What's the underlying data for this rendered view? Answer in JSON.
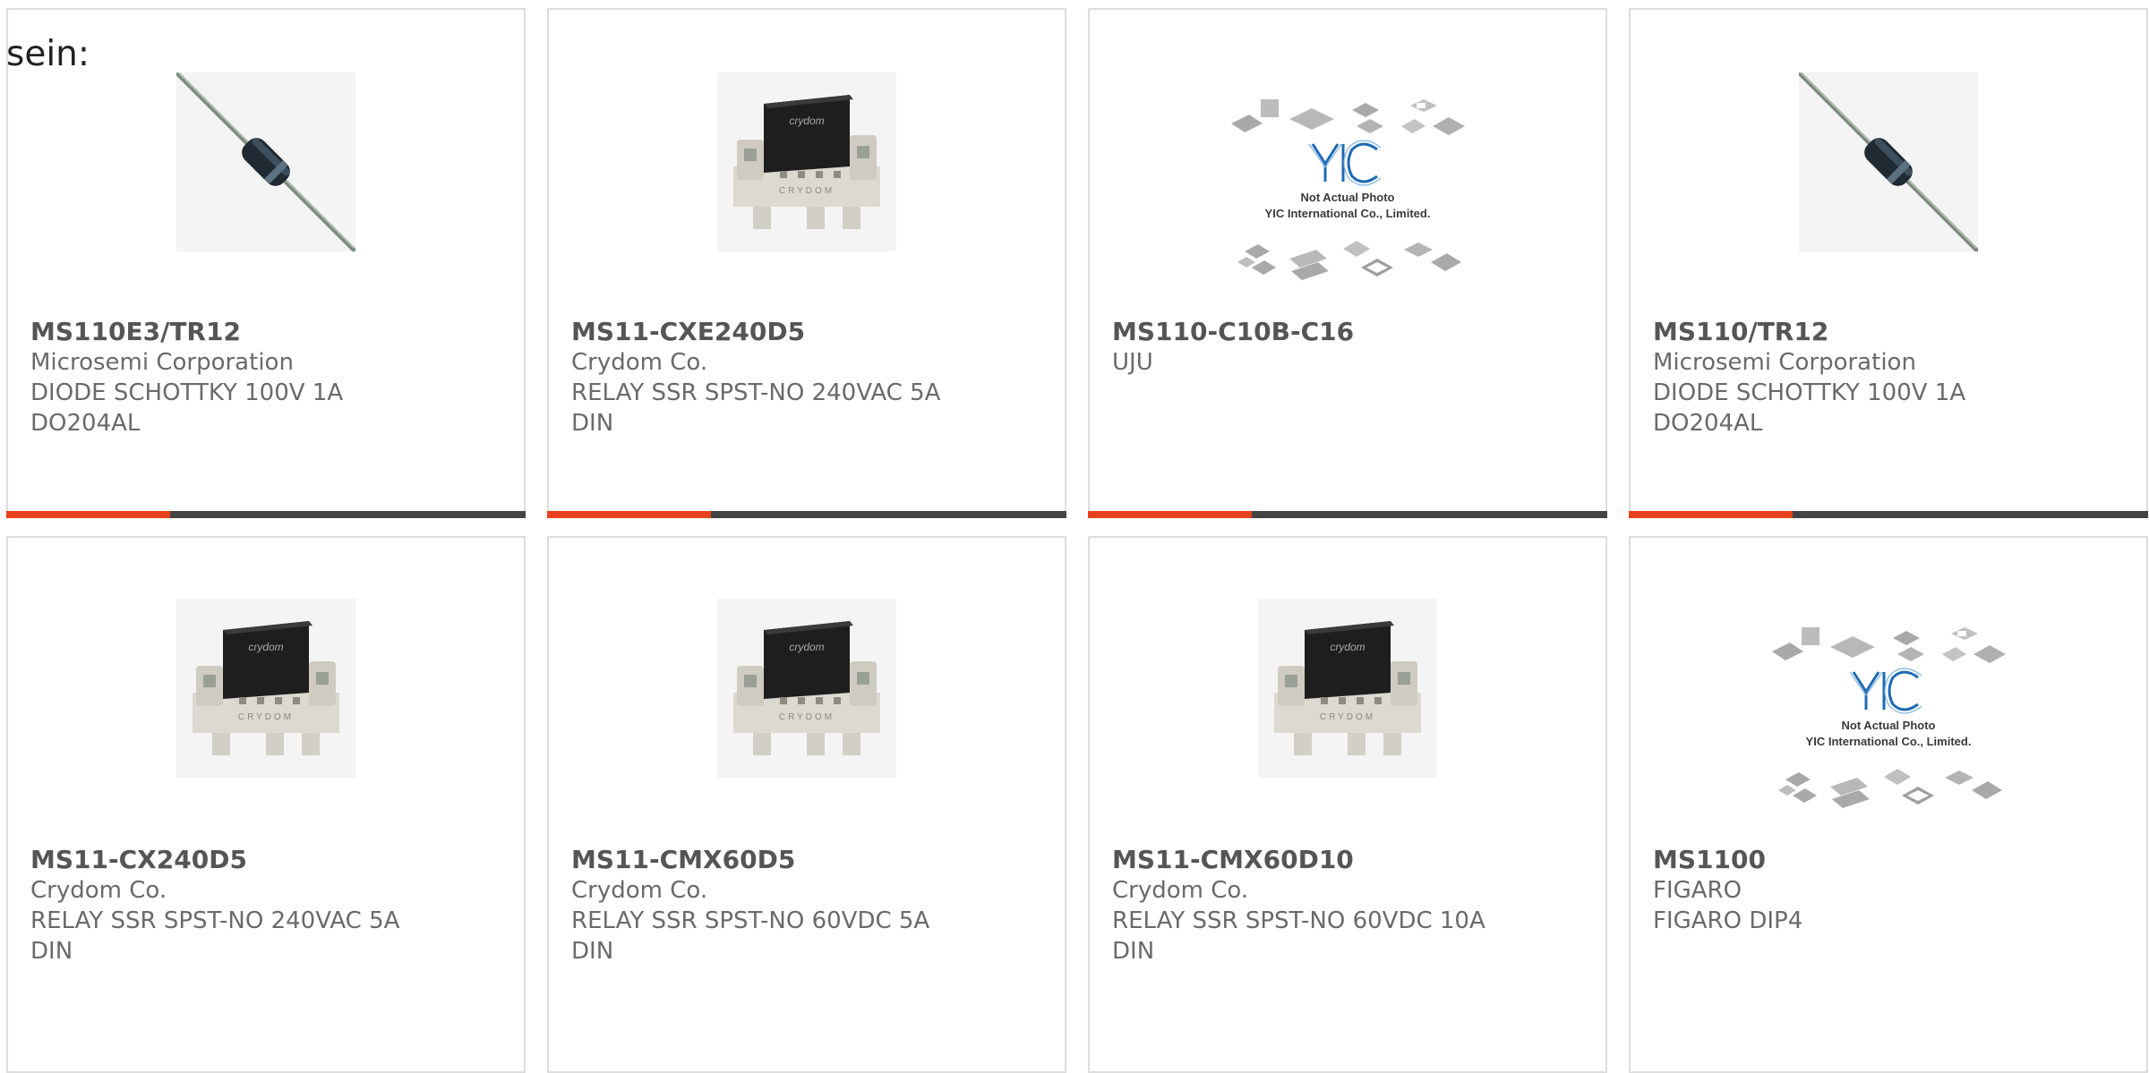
{
  "intro_text": "sein:",
  "colors": {
    "accent": "#e8401c",
    "bar": "#444444",
    "border": "#dddddd"
  },
  "products": [
    {
      "part": "MS110E3/TR12",
      "maker": "Microsemi Corporation",
      "desc1": "DIODE SCHOTTKY 100V 1A",
      "desc2": "DO204AL",
      "image": "diode-icon"
    },
    {
      "part": "MS11-CXE240D5",
      "maker": "Crydom Co.",
      "desc1": "RELAY SSR SPST-NO 240VAC 5A",
      "desc2": "DIN",
      "image": "relay-icon"
    },
    {
      "part": "MS110-C10B-C16",
      "maker": "UJU",
      "desc1": "",
      "desc2": "",
      "image": "placeholder-icon"
    },
    {
      "part": "MS110/TR12",
      "maker": "Microsemi Corporation",
      "desc1": "DIODE SCHOTTKY 100V 1A",
      "desc2": "DO204AL",
      "image": "diode-icon"
    },
    {
      "part": "MS11-CX240D5",
      "maker": "Crydom Co.",
      "desc1": "RELAY SSR SPST-NO 240VAC 5A",
      "desc2": "DIN",
      "image": "relay-icon"
    },
    {
      "part": "MS11-CMX60D5",
      "maker": "Crydom Co.",
      "desc1": "RELAY SSR SPST-NO 60VDC 5A",
      "desc2": "DIN",
      "image": "relay-icon"
    },
    {
      "part": "MS11-CMX60D10",
      "maker": "Crydom Co.",
      "desc1": "RELAY SSR SPST-NO 60VDC 10A",
      "desc2": "DIN",
      "image": "relay-icon"
    },
    {
      "part": "MS1100",
      "maker": "FIGARO",
      "desc1": "FIGARO DIP4",
      "desc2": "",
      "image": "placeholder-icon"
    }
  ],
  "placeholder": {
    "logo": "YIC",
    "line1": "Not Actual Photo",
    "line2": "YIC International Co., Limited."
  },
  "relay_labels": {
    "top": "crydom",
    "front": "CRYDOM"
  }
}
